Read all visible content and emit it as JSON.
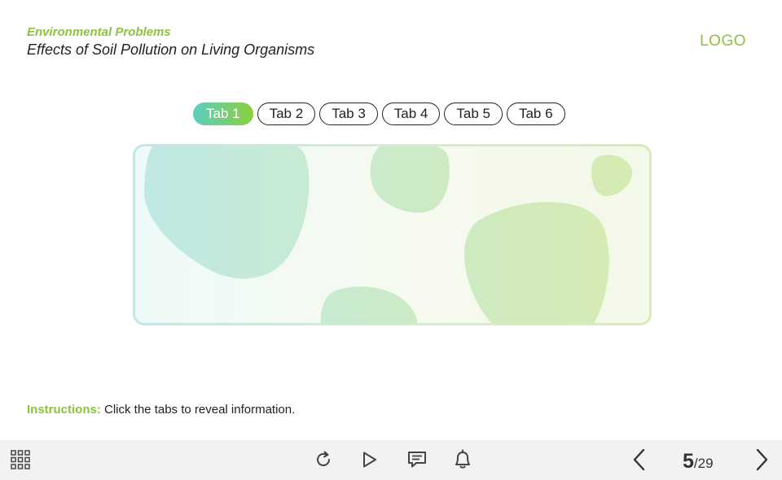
{
  "header": {
    "category": "Environmental Problems",
    "title": "Effects of Soil Pollution on Living Organisms",
    "logo": "LOGO"
  },
  "tabs": [
    {
      "label": "Tab 1",
      "active": true
    },
    {
      "label": "Tab 2",
      "active": false
    },
    {
      "label": "Tab 3",
      "active": false
    },
    {
      "label": "Tab 4",
      "active": false
    },
    {
      "label": "Tab 5",
      "active": false
    },
    {
      "label": "Tab 6",
      "active": false
    }
  ],
  "instructions": {
    "label": "Instructions:",
    "text": " Click the tabs to reveal information."
  },
  "toolbar": {
    "menu_icon": "grid-menu-icon",
    "replay_icon": "replay-icon",
    "play_icon": "play-icon",
    "transcript_icon": "transcript-icon",
    "notification_icon": "bell-icon",
    "prev_icon": "chevron-left-icon",
    "next_icon": "chevron-right-icon"
  },
  "pagination": {
    "current": "5",
    "total": "/29"
  },
  "colors": {
    "accent": "#8cc33c",
    "tab_gradient_start": "#5ccdbf",
    "tab_gradient_end": "#8ccf3c",
    "toolbar_bg": "#f2f2f2",
    "text": "#222222"
  }
}
